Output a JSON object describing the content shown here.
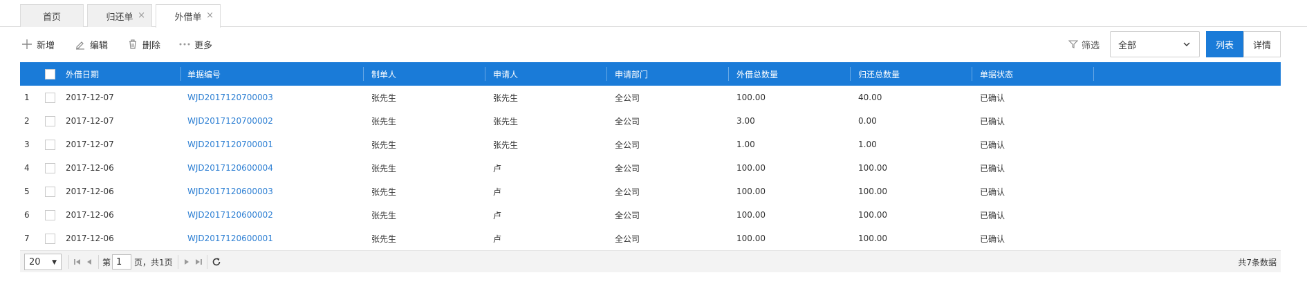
{
  "tabs": [
    {
      "label": "首页",
      "closable": false,
      "active": false
    },
    {
      "label": "归还单",
      "closable": true,
      "active": false
    },
    {
      "label": "外借单",
      "closable": true,
      "active": true
    }
  ],
  "toolbar": {
    "add_label": "新增",
    "edit_label": "编辑",
    "delete_label": "删除",
    "more_label": "更多",
    "filter_label": "筛选",
    "filter_value": "全部",
    "view_list_label": "列表",
    "view_detail_label": "详情"
  },
  "table": {
    "columns": [
      "外借日期",
      "单据编号",
      "制单人",
      "申请人",
      "申请部门",
      "外借总数量",
      "归还总数量",
      "单据状态"
    ],
    "rows": [
      {
        "num": "1",
        "date": "2017-12-07",
        "code": "WJD2017120700003",
        "maker": "张先生",
        "applicant": "张先生",
        "dept": "全公司",
        "lend_qty": "100.00",
        "return_qty": "40.00",
        "status": "已确认"
      },
      {
        "num": "2",
        "date": "2017-12-07",
        "code": "WJD2017120700002",
        "maker": "张先生",
        "applicant": "张先生",
        "dept": "全公司",
        "lend_qty": "3.00",
        "return_qty": "0.00",
        "status": "已确认"
      },
      {
        "num": "3",
        "date": "2017-12-07",
        "code": "WJD2017120700001",
        "maker": "张先生",
        "applicant": "张先生",
        "dept": "全公司",
        "lend_qty": "1.00",
        "return_qty": "1.00",
        "status": "已确认"
      },
      {
        "num": "4",
        "date": "2017-12-06",
        "code": "WJD2017120600004",
        "maker": "张先生",
        "applicant": "卢",
        "dept": "全公司",
        "lend_qty": "100.00",
        "return_qty": "100.00",
        "status": "已确认"
      },
      {
        "num": "5",
        "date": "2017-12-06",
        "code": "WJD2017120600003",
        "maker": "张先生",
        "applicant": "卢",
        "dept": "全公司",
        "lend_qty": "100.00",
        "return_qty": "100.00",
        "status": "已确认"
      },
      {
        "num": "6",
        "date": "2017-12-06",
        "code": "WJD2017120600002",
        "maker": "张先生",
        "applicant": "卢",
        "dept": "全公司",
        "lend_qty": "100.00",
        "return_qty": "100.00",
        "status": "已确认"
      },
      {
        "num": "7",
        "date": "2017-12-06",
        "code": "WJD2017120600001",
        "maker": "张先生",
        "applicant": "卢",
        "dept": "全公司",
        "lend_qty": "100.00",
        "return_qty": "100.00",
        "status": "已确认"
      }
    ]
  },
  "pager": {
    "page_size": "20",
    "page_prefix": "第",
    "page_value": "1",
    "page_suffix": "页，共1页",
    "total": "共7条数据"
  },
  "colors": {
    "accent": "#1a7bd8",
    "link": "#2d7fd3"
  }
}
